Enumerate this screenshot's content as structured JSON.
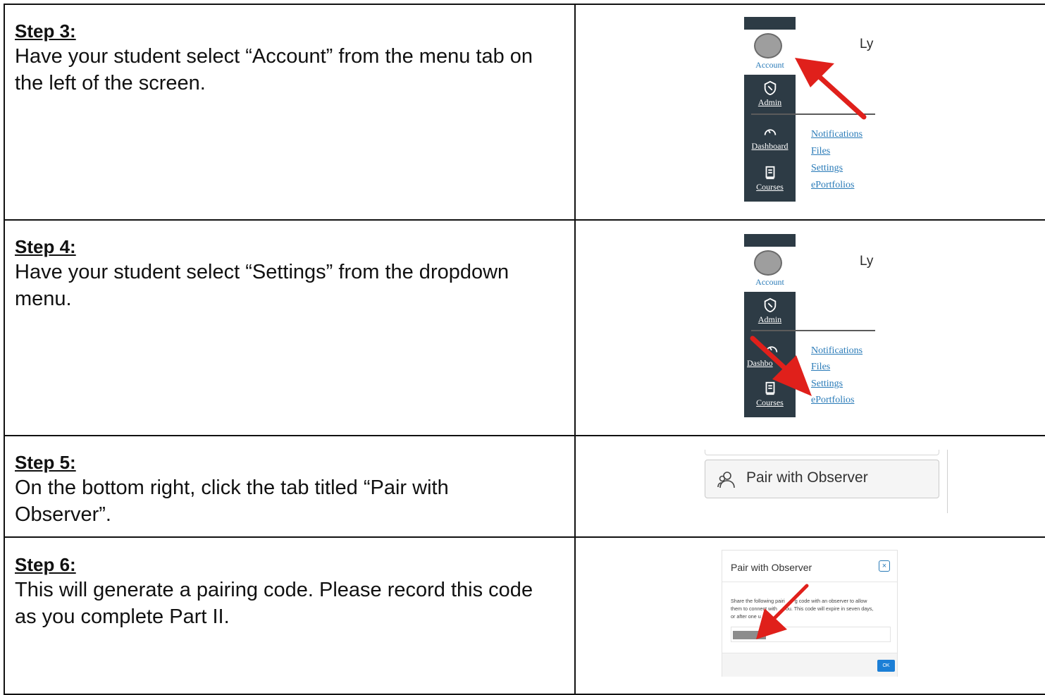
{
  "steps": [
    {
      "title": "Step 3:",
      "body": "Have your student select “Account” from the menu tab on the left of the screen."
    },
    {
      "title": "Step 4:",
      "body": "Have your student select “Settings” from the dropdown menu."
    },
    {
      "title": "Step 5:",
      "body": "On the bottom right, click the tab titled “Pair with Observer”."
    },
    {
      "title": "Step 6:",
      "body": "This will generate a pairing code.  Please record this code as you complete Part II."
    }
  ],
  "canvas_menu": {
    "account_label": "Account",
    "admin_label": "Admin",
    "dashboard_label": "Dashboard",
    "courses_label": "Courses",
    "user_initials": "Ly",
    "tray_links": [
      "Notifications",
      "Files",
      "Settings",
      "ePortfolios"
    ]
  },
  "canvas_menu_step4": {
    "dashboard_label_visible": "Dashbo"
  },
  "pair_button": {
    "label": "Pair with Observer"
  },
  "pair_dialog": {
    "title": "Pair with Observer",
    "close_glyph": "×",
    "message_line1": "Share the following pairi",
    "message_line1b": "g code with an observer to allow",
    "message_line2": "them to connect with",
    "message_line2b": "ou. This code will expire in seven days,",
    "message_line3": "or after one u",
    "ok_label": "OK"
  },
  "colors": {
    "rail": "#2d3b45",
    "link": "#2a7bb8",
    "arrow": "#e0201b",
    "ok_button": "#1c7fd6"
  }
}
